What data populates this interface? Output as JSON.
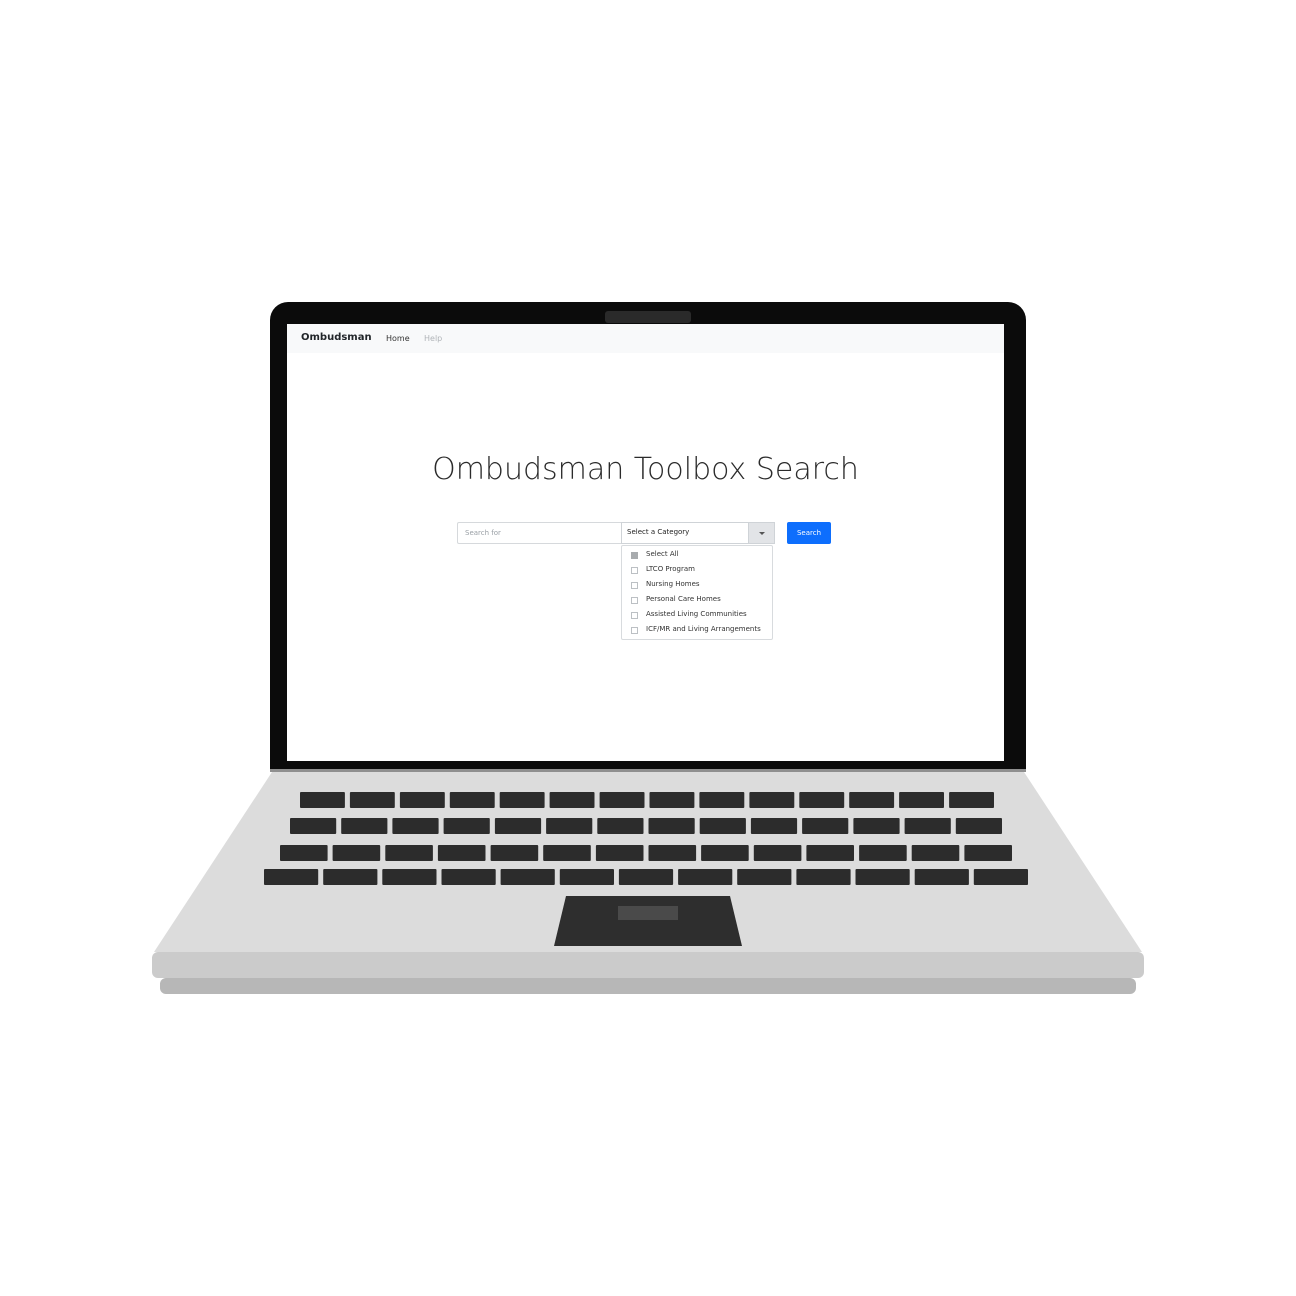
{
  "navbar": {
    "brand": "Ombudsman",
    "links": [
      {
        "label": "Home",
        "active": true
      },
      {
        "label": "Help",
        "active": false
      }
    ]
  },
  "main": {
    "title": "Ombudsman Toolbox Search",
    "search": {
      "placeholder": "Search for",
      "value": ""
    },
    "category_select": {
      "selected_label": "Select a Category",
      "options": [
        {
          "label": "Select All",
          "checked": true
        },
        {
          "label": "LTCO Program",
          "checked": false
        },
        {
          "label": "Nursing Homes",
          "checked": false
        },
        {
          "label": "Personal Care Homes",
          "checked": false
        },
        {
          "label": "Assisted Living Communities",
          "checked": false
        },
        {
          "label": "ICF/MR and Living Arrangements",
          "checked": false
        }
      ]
    },
    "search_button_label": "Search"
  },
  "colors": {
    "primary": "#0d6efd",
    "bezel": "#0b0b0b",
    "laptop_body": "#dcdcdc",
    "keys": "#2b2b2b"
  }
}
